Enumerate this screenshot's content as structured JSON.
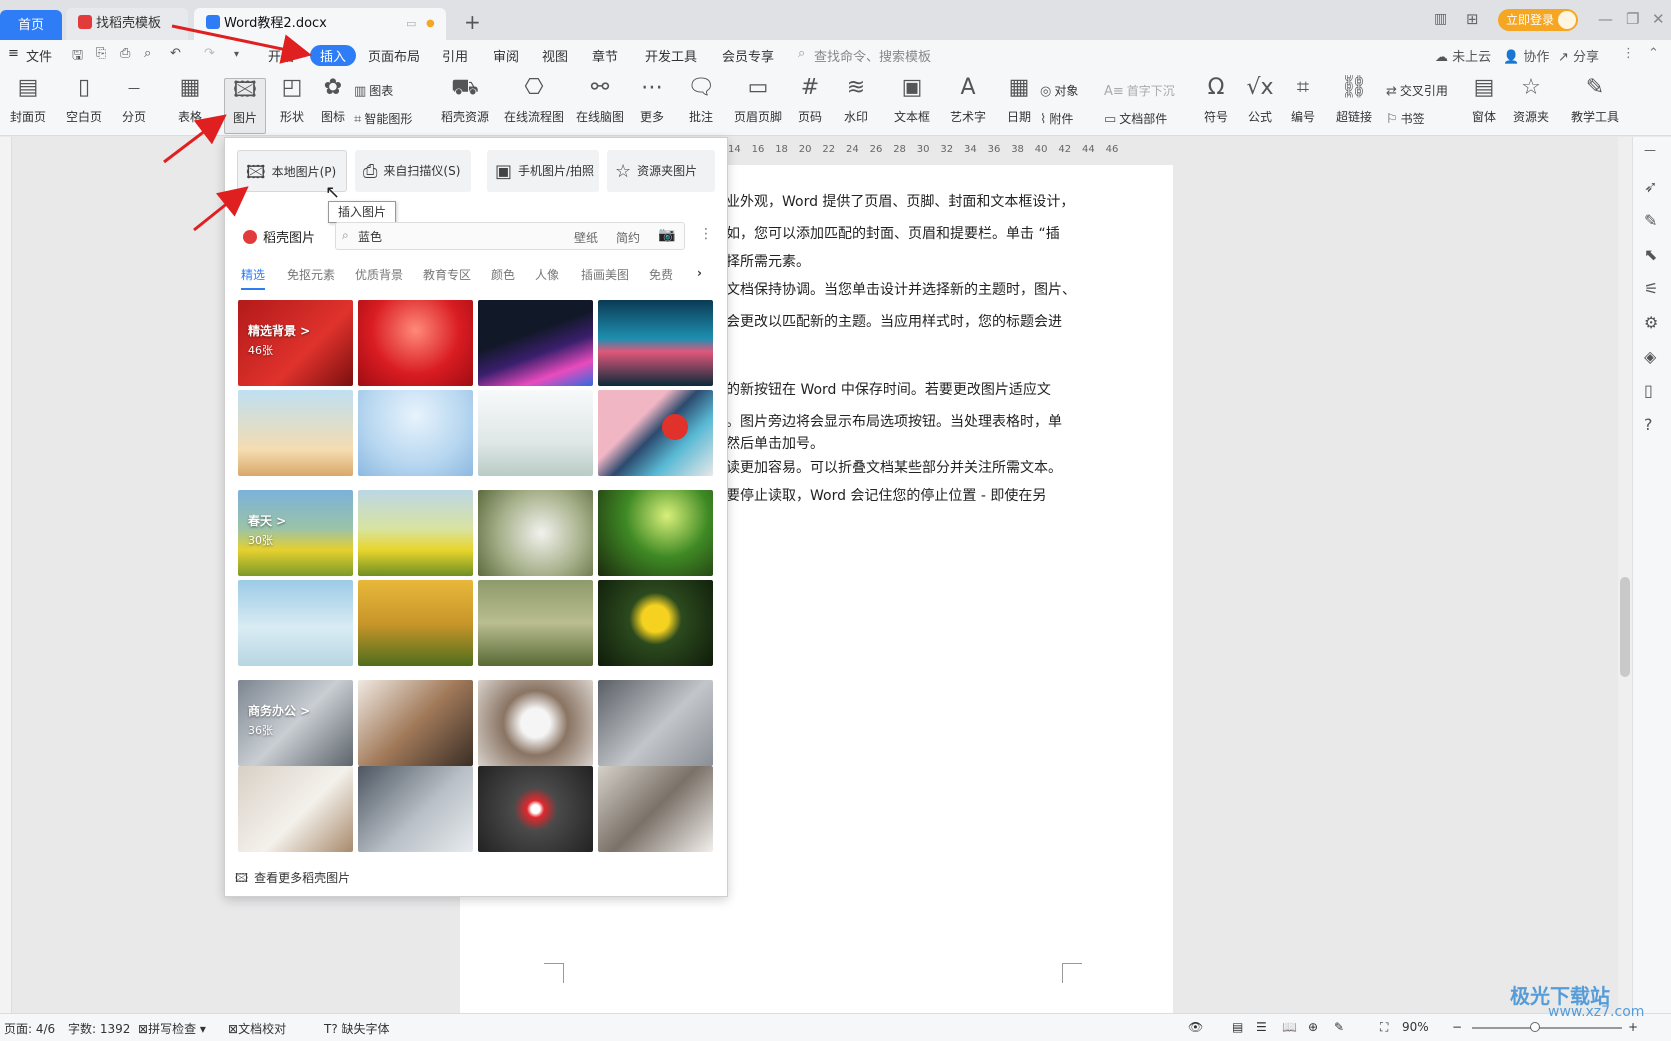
{
  "titlebar": {
    "tabs": [
      {
        "label": "首页"
      },
      {
        "label": "找稻壳模板"
      },
      {
        "label": "Word教程2.docx"
      }
    ],
    "new_tab": "+",
    "login": "立即登录",
    "window_controls": [
      "—",
      "❐",
      "✕"
    ]
  },
  "menubar": {
    "file": "文件",
    "items": [
      "开始",
      "插入",
      "页面布局",
      "引用",
      "审阅",
      "视图",
      "章节",
      "开发工具",
      "会员专享"
    ],
    "search_placeholder": "查找命令、搜索模板",
    "right": [
      "未上云",
      "协作",
      "分享"
    ]
  },
  "ribbon": {
    "big_buttons": [
      "封面页",
      "空白页",
      "分页",
      "表格",
      "图片",
      "形状",
      "图标",
      "稻壳资源",
      "在线流程图",
      "在线脑图",
      "更多",
      "批注",
      "页眉页脚",
      "页码",
      "水印",
      "文本框",
      "艺术字",
      "日期",
      "符号",
      "公式",
      "编号",
      "超链接",
      "窗体",
      "资源夹",
      "教学工具"
    ],
    "small_buttons": [
      "图表",
      "智能图形",
      "对象",
      "首字下沉",
      "附件",
      "文档部件",
      "交叉引用",
      "书签"
    ]
  },
  "ruler_ticks": [
    "14",
    "16",
    "18",
    "20",
    "22",
    "24",
    "26",
    "28",
    "30",
    "32",
    "34",
    "36",
    "38",
    "40",
    "42",
    "44",
    "46"
  ],
  "document": {
    "lines": [
      "业外观，Word 提供了页眉、页脚、封面和文本框设计，",
      "如，您可以添加匹配的封面、页眉和提要栏。单击 “插",
      "择所需元素。",
      "文档保持协调。当您单击设计并选择新的主题时，图片、",
      "会更改以匹配新的主题。当应用样式时，您的标题会进",
      "的新按钮在 Word 中保存时间。若要更改图片适应文",
      "。图片旁边将会显示布局选项按钮。当处理表格时，单",
      "然后单击加号。",
      "读更加容易。可以折叠文档某些部分并关注所需文本。",
      "要停止读取，Word 会记住您的停止位置 - 即使在另"
    ]
  },
  "picture_menu": {
    "sources": [
      "本地图片(P)",
      "来自扫描仪(S)",
      "手机图片/拍照",
      "资源夹图片"
    ],
    "tooltip": "插入图片",
    "brand": "稻壳图片",
    "search_value": "蓝色",
    "search_tags": [
      "壁纸",
      "简约"
    ],
    "categories": [
      "精选",
      "免抠元素",
      "优质背景",
      "教育专区",
      "颜色",
      "人像",
      "插画美图",
      "免费"
    ],
    "groups": [
      {
        "title": "精选背景 >",
        "count": "46张"
      },
      {
        "title": "春天 >",
        "count": "30张"
      },
      {
        "title": "商务办公 >",
        "count": "36张"
      }
    ],
    "more": "查看更多稻壳图片"
  },
  "statusbar": {
    "page": "页面: 4/6",
    "words": "字数: 1392",
    "spell": "拼写检查",
    "proof": "文档校对",
    "missing_font": "缺失字体",
    "zoom": "90%"
  },
  "watermark": {
    "name": "极光下载站",
    "url": "www.xz7.com"
  },
  "colors": {
    "accent": "#2f7df6",
    "login": "#f5a623",
    "arrow": "#e02020"
  }
}
